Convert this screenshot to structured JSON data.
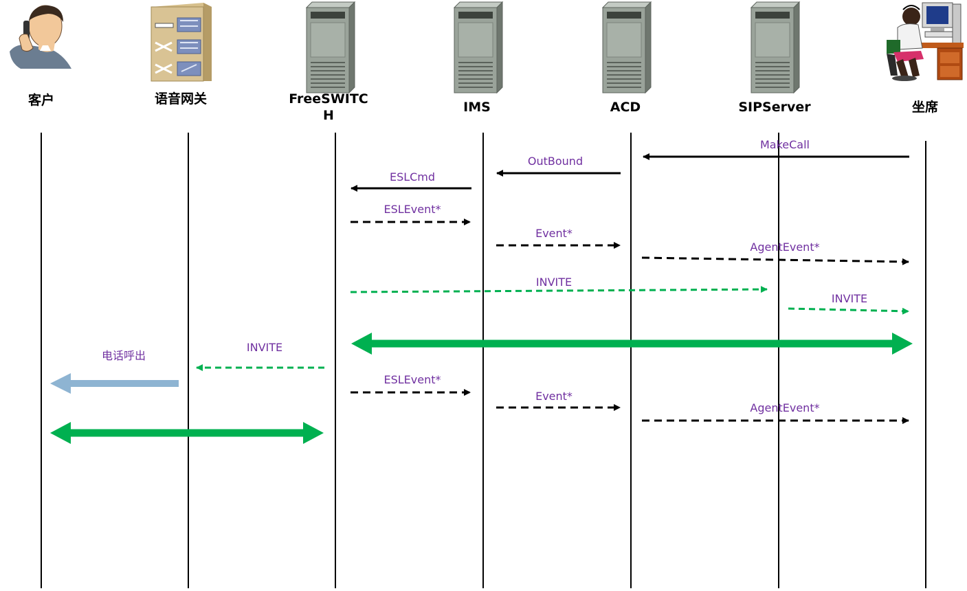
{
  "colors": {
    "label": "#7030a0",
    "black": "#000000",
    "green": "#00b050",
    "blue": "#8eb4d2"
  },
  "actors": [
    {
      "name": "客户",
      "icon": "phone-person-icon"
    },
    {
      "name": "语音网关",
      "icon": "voice-gateway-icon"
    },
    {
      "name": "FreeSWITCH",
      "icon": "server-icon"
    },
    {
      "name": "IMS",
      "icon": "server-icon"
    },
    {
      "name": "ACD",
      "icon": "server-icon"
    },
    {
      "name": "SIPServer",
      "icon": "server-icon"
    },
    {
      "name": "坐席",
      "icon": "agent-workstation-icon"
    }
  ],
  "messages": [
    {
      "label": "MakeCall",
      "style": "solid-black"
    },
    {
      "label": "OutBound",
      "style": "solid-black"
    },
    {
      "label": "ESLCmd",
      "style": "solid-black"
    },
    {
      "label": "ESLEvent*",
      "style": "dashed-black"
    },
    {
      "label": "Event*",
      "style": "dashed-black"
    },
    {
      "label": "AgentEvent*",
      "style": "dashed-black"
    },
    {
      "label": "INVITE",
      "style": "dashed-green"
    },
    {
      "label": "INVITE",
      "style": "dashed-green"
    },
    {
      "label": "",
      "style": "thick-green-double"
    },
    {
      "label": "INVITE",
      "style": "dashed-green"
    },
    {
      "label": "电话呼出",
      "style": "thick-blue"
    },
    {
      "label": "ESLEvent*",
      "style": "dashed-black"
    },
    {
      "label": "Event*",
      "style": "dashed-black"
    },
    {
      "label": "AgentEvent*",
      "style": "dashed-black"
    },
    {
      "label": "",
      "style": "thick-green-double"
    }
  ]
}
